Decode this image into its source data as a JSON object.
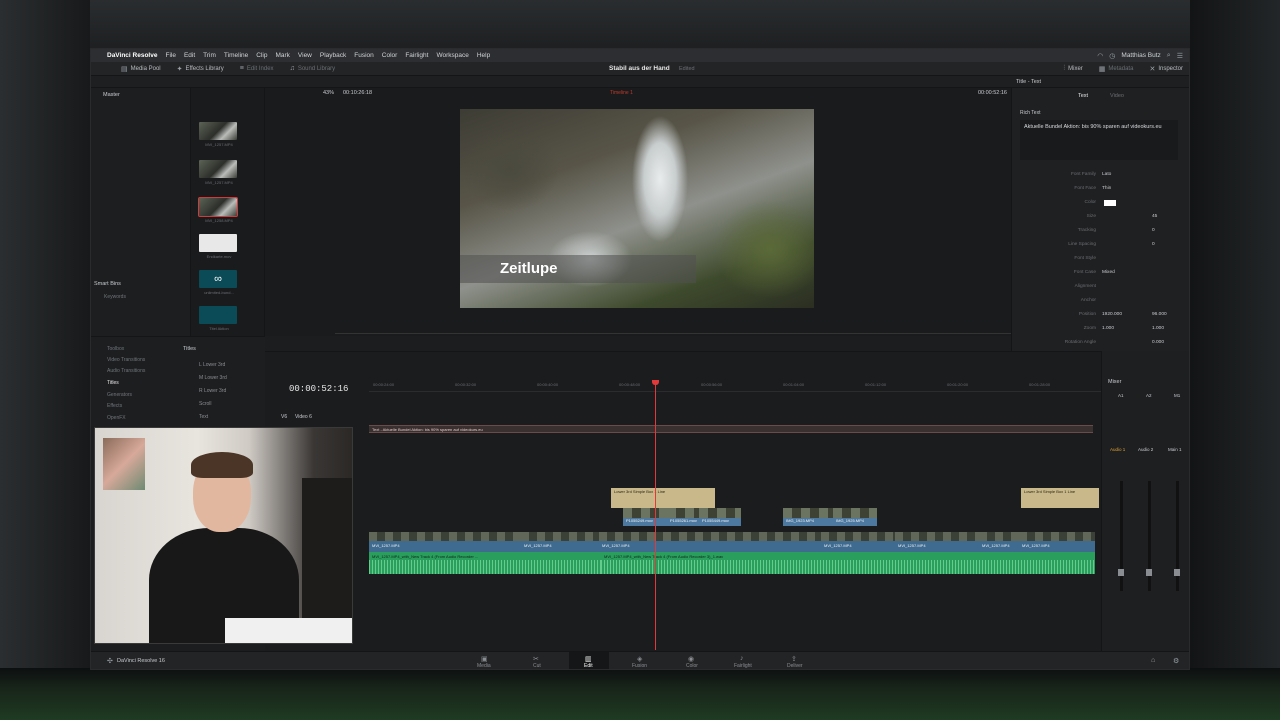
{
  "menubar": {
    "apple_icon": "apple-icon",
    "app_name": "DaVinci Resolve",
    "items": [
      "File",
      "Edit",
      "Trim",
      "Timeline",
      "Clip",
      "Mark",
      "View",
      "Playback",
      "Fusion",
      "Color",
      "Fairlight",
      "Workspace",
      "Help"
    ],
    "user": "Matthias Butz"
  },
  "toolbar": {
    "media_pool": "Media Pool",
    "effects_library": "Effects Library",
    "edit_index": "Edit Index",
    "sound_library": "Sound Library",
    "project_title": "Stabil aus der Hand",
    "status": "Edited",
    "mixer": "Mixer",
    "metadata": "Metadata",
    "inspector": "Inspector"
  },
  "viewer": {
    "zoom": "43%",
    "timecode": "00:10:26:18",
    "timeline_name": "Timeline 1",
    "timecode_right": "00:00:52:16",
    "overlay_title": "Zeitlupe"
  },
  "media_pool": {
    "master": "Master",
    "smart_bins": "Smart Bins",
    "keywords": "Keywords",
    "clips": [
      {
        "label": "MVI_1257.MP4"
      },
      {
        "label": "MVI_1257.MP4"
      },
      {
        "label": "MVI_1258.MP4"
      },
      {
        "label": "Endkarte.mov"
      },
      {
        "label": "unlimited-bund..."
      },
      {
        "label": "Titel Aktion"
      }
    ],
    "logo_text": "∞"
  },
  "inspector": {
    "title": "Title - Text",
    "tab_text": "Text",
    "tab_video": "Video",
    "rich_text": "Rich Text",
    "text_value": "Aktuelle Bundel Aktion: bis 90% sparen auf videokurs.eu",
    "props": [
      {
        "label": "Font Family",
        "value": "Lato",
        "value2": ""
      },
      {
        "label": "Font Face",
        "value": "Thin",
        "value2": ""
      },
      {
        "label": "Color",
        "value": "",
        "value2": ""
      },
      {
        "label": "Size",
        "value": "",
        "value2": "45"
      },
      {
        "label": "Tracking",
        "value": "",
        "value2": "0"
      },
      {
        "label": "Line Spacing",
        "value": "",
        "value2": "0"
      },
      {
        "label": "Font Style",
        "value": "",
        "value2": ""
      },
      {
        "label": "Font Case",
        "value": "Mixed",
        "value2": ""
      },
      {
        "label": "Alignment",
        "value": "",
        "value2": ""
      },
      {
        "label": "Anchor",
        "value": "",
        "value2": ""
      },
      {
        "label": "Position",
        "value": "1920.000",
        "value2": "96.000"
      },
      {
        "label": "Zoom",
        "value": "1.000",
        "value2": "1.000"
      },
      {
        "label": "Rotation Angle",
        "value": "",
        "value2": "0.000"
      }
    ]
  },
  "effects": {
    "tree": [
      "Toolbox",
      "Video Transitions",
      "Audio Transitions",
      "Titles",
      "Generators",
      "Effects",
      "OpenFX"
    ],
    "active": "Titles",
    "heading": "Titles",
    "list": [
      "L Lower 3rd",
      "M Lower 3rd",
      "R Lower 3rd",
      "Scroll",
      "Text"
    ]
  },
  "timeline": {
    "big_timecode": "00:00:52:16",
    "ruler": [
      "00:00:24:00",
      "00:00:32:00",
      "00:00:40:00",
      "00:00:48:00",
      "00:00:56:00",
      "00:01:04:00",
      "00:01:12:00",
      "00:01:20:00",
      "00:01:28:00"
    ],
    "track_v6": "V6",
    "track_v6_name": "Video 6",
    "title_clip": "Text - Aktuelle Bundel Aktion: bis 90% sparen auf videokurs.eu",
    "text_clip_1": "Lower 3rd Simple Box 1 Line",
    "text_clip_2": "Lower 3rd Simple Box 1 Line",
    "broll_clips": [
      "P1055249.mov",
      "P1055261.mov",
      "P1055449.mov",
      "IMG_1923.MP4",
      "IMG_1925.MP4"
    ],
    "main_clips": [
      "MVI_1257.MP4",
      "MVI_1257.MP4",
      "MVI_1257.MP4",
      "MVI_1257.MP4",
      "MVI_1257.MP4",
      "MVI_1257.MP4",
      "MVI_1257.MP4"
    ],
    "audio_1": "MVI_1257.MP4_with_New Track 4 (From Audio Recorder ...",
    "audio_2": "MVI_1257.MP4_with_New Track 4 (From Audio Recorder 3)_1.wav"
  },
  "mixer": {
    "title": "Mixer",
    "channels": [
      "A1",
      "A2",
      "M1"
    ],
    "channel_names": [
      "Audio 1",
      "Audio 2",
      "Main 1"
    ]
  },
  "pages": {
    "brand": "DaVinci Resolve 16",
    "items": [
      "Media",
      "Cut",
      "Edit",
      "Fusion",
      "Color",
      "Fairlight",
      "Deliver"
    ],
    "active": "Edit"
  }
}
